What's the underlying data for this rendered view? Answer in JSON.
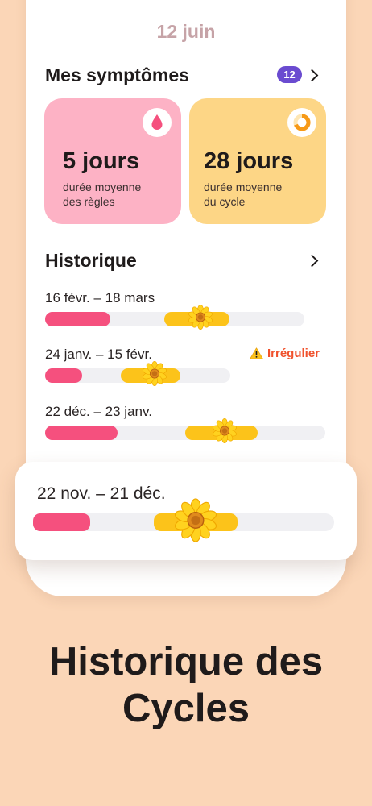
{
  "header": {
    "date": "12 juin"
  },
  "symptoms": {
    "title": "Mes symptômes",
    "count": "12"
  },
  "stats": [
    {
      "value": "5 jours",
      "desc_line1": "durée moyenne",
      "desc_line2": "des règles",
      "icon": "drop-icon",
      "color": "#fdb2c5"
    },
    {
      "value": "28 jours",
      "desc_line1": "durée moyenne",
      "desc_line2": "du cycle",
      "icon": "cycle-ring-icon",
      "color": "#fdd686"
    }
  ],
  "history": {
    "title": "Historique",
    "warning_label": "Irrégulier",
    "cycles": [
      {
        "label": "16 févr. – 18 mars",
        "period_fraction": 0.25,
        "fertile_start_fraction": 0.46,
        "fertile_end_fraction": 0.71,
        "ovulation_fraction": 0.6
      },
      {
        "label": "24 janv. – 15 févr.",
        "period_fraction": 0.2,
        "fertile_start_fraction": 0.41,
        "fertile_end_fraction": 0.73,
        "ovulation_fraction": 0.59,
        "irregular": true
      },
      {
        "label": "22 déc. – 23 janv.",
        "period_fraction": 0.26,
        "fertile_start_fraction": 0.5,
        "fertile_end_fraction": 0.76,
        "ovulation_fraction": 0.64
      }
    ],
    "highlight": {
      "label": "22 nov. – 21 déc.",
      "period_fraction": 0.19,
      "fertile_start_fraction": 0.4,
      "fertile_end_fraction": 0.68,
      "ovulation_fraction": 0.54
    }
  },
  "headline": {
    "line1": "Historique des",
    "line2": "Cycles"
  },
  "colors": {
    "period": "#f5507e",
    "fertile": "#fcc31a",
    "track": "#f0f0f3",
    "accent_badge": "#6a4bd0",
    "warning": "#f0512c",
    "background": "#fbd6b7"
  }
}
